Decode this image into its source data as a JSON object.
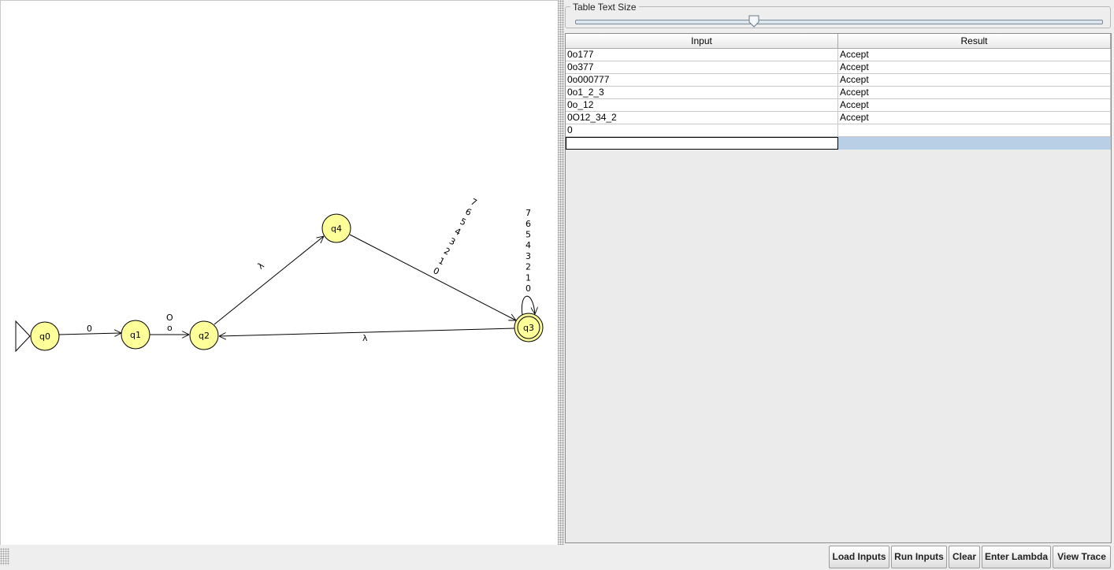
{
  "automaton": {
    "states": [
      {
        "id": "q0",
        "initial": true,
        "final": false
      },
      {
        "id": "q1",
        "initial": false,
        "final": false
      },
      {
        "id": "q2",
        "initial": false,
        "final": false
      },
      {
        "id": "q3",
        "initial": false,
        "final": true
      },
      {
        "id": "q4",
        "initial": false,
        "final": false
      }
    ],
    "transitions": [
      {
        "from": "q0",
        "to": "q1",
        "labels": [
          "0"
        ]
      },
      {
        "from": "q1",
        "to": "q2",
        "labels": [
          "O",
          "o"
        ]
      },
      {
        "from": "q2",
        "to": "q4",
        "labels": [
          "λ"
        ]
      },
      {
        "from": "q4",
        "to": "q3",
        "labels": [
          "0",
          "1",
          "2",
          "3",
          "4",
          "5",
          "6",
          "7"
        ]
      },
      {
        "from": "q3",
        "to": "q3",
        "labels": [
          "0",
          "1",
          "2",
          "3",
          "4",
          "5",
          "6",
          "7"
        ]
      },
      {
        "from": "q3",
        "to": "q2",
        "labels": [
          "λ"
        ]
      }
    ]
  },
  "slider": {
    "title": "Table Text Size",
    "value_fraction": 0.34
  },
  "table": {
    "headers": [
      "Input",
      "Result"
    ],
    "rows": [
      {
        "input": "0o177",
        "result": "Accept"
      },
      {
        "input": "0o377",
        "result": "Accept"
      },
      {
        "input": "0o000777",
        "result": "Accept"
      },
      {
        "input": "0o1_2_3",
        "result": "Accept"
      },
      {
        "input": "0o_12",
        "result": "Accept"
      },
      {
        "input": "0O12_34_2",
        "result": "Accept"
      },
      {
        "input": "0",
        "result": ""
      }
    ],
    "editing_row": {
      "input": "",
      "result": ""
    }
  },
  "buttons": {
    "load": "Load Inputs",
    "run": "Run Inputs",
    "clear": "Clear",
    "lambda": "Enter Lambda",
    "trace": "View Trace"
  }
}
